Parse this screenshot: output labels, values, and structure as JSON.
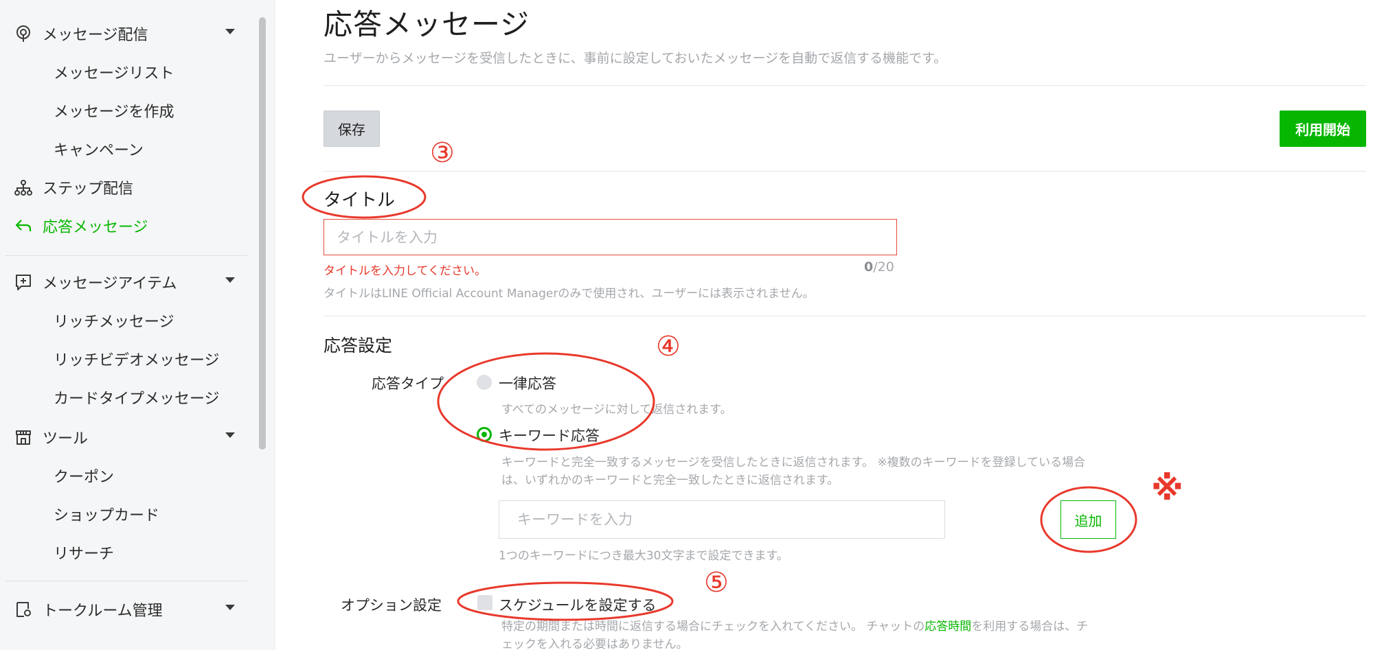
{
  "sidebar": {
    "message_delivery": "メッセージ配信",
    "message_list": "メッセージリスト",
    "create_message": "メッセージを作成",
    "campaign": "キャンペーン",
    "step_delivery": "ステップ配信",
    "auto_reply": "応答メッセージ",
    "message_items": "メッセージアイテム",
    "rich_message": "リッチメッセージ",
    "rich_video": "リッチビデオメッセージ",
    "card_type": "カードタイプメッセージ",
    "tools": "ツール",
    "coupon": "クーポン",
    "shop_card": "ショップカード",
    "research": "リサーチ",
    "chat_room": "トークルーム管理"
  },
  "main": {
    "title": "応答メッセージ",
    "description": "ユーザーからメッセージを受信したときに、事前に設定しておいたメッセージを自動で返信する機能です。",
    "save_label": "保存",
    "start_label": "利用開始",
    "title_section": {
      "heading": "タイトル",
      "placeholder": "タイトルを入力",
      "error": "タイトルを入力してください。",
      "count_current": "0",
      "count_max": "/20",
      "hint": "タイトルはLINE Official Account Managerのみで使用され、ユーザーには表示されません。"
    },
    "reply_settings": {
      "heading": "応答設定",
      "type_label": "応答タイプ",
      "option_all": "一律応答",
      "option_all_desc": "すべてのメッセージに対して返信されます。",
      "option_keyword": "キーワード応答",
      "option_keyword_desc_1": "キーワードと完全一致するメッセージを受信したときに返信されます。 ※複数のキーワードを登録している場合",
      "option_keyword_desc_2": "は、いずれかのキーワードと完全一致したときに返信されます。",
      "keyword_placeholder": "キーワードを入力",
      "add_label": "追加",
      "keyword_hint": "1つのキーワードにつき最大30文字まで設定できます。"
    },
    "options": {
      "label": "オプション設定",
      "schedule_label": "スケジュールを設定する",
      "schedule_desc_1a": "特定の期間または時間に返信する場合にチェックを入れてください。 チャットの",
      "schedule_desc_link": "応答時間",
      "schedule_desc_1b": "を利用する場合は、チ",
      "schedule_desc_2": "ェックを入れる必要はありません。"
    }
  },
  "annotations": {
    "n3": "③",
    "n4": "④",
    "n5": "⑤",
    "mark": "※"
  },
  "colors": {
    "accent": "#06b600",
    "annotation": "#e8382b",
    "error": "#e8382b"
  }
}
